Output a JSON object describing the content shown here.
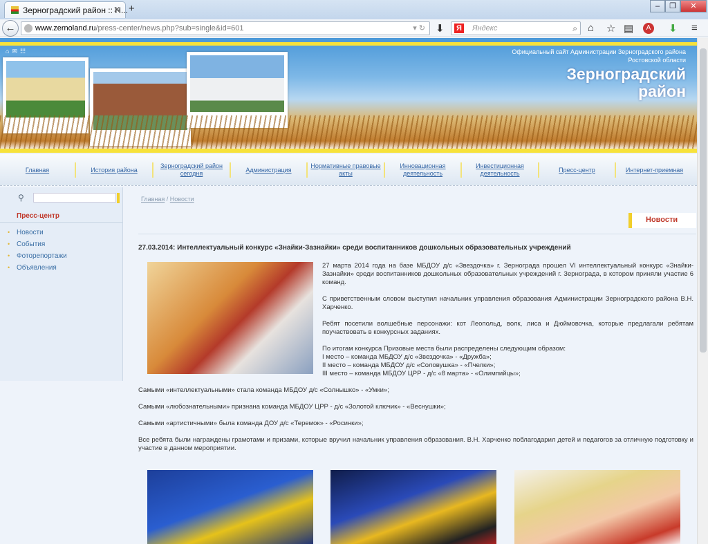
{
  "browser": {
    "tab_title": "Зерноградский район :: Н...",
    "url_host": "www.zernoland.ru",
    "url_path": "/press-center/news.php?sub=single&id=601",
    "search_placeholder": "Яндекс"
  },
  "header": {
    "official_line1": "Официальный сайт Администрации Зерноградского района",
    "official_line2": "Ростовской области",
    "district_line1": "Зерноградский",
    "district_line2": "район"
  },
  "menu": [
    {
      "label": "Главная"
    },
    {
      "label": "История района"
    },
    {
      "label": "Зерноградский район сегодня"
    },
    {
      "label": "Администрация"
    },
    {
      "label": "Нормативные правовые акты"
    },
    {
      "label": "Инновационная деятельность"
    },
    {
      "label": "Инвестиционная деятельность"
    },
    {
      "label": "Пресс-центр"
    },
    {
      "label": "Интернет-приемная"
    }
  ],
  "sidebar": {
    "section_title": "Пресс-центр",
    "items": [
      "Новости",
      "События",
      "Фоторепортажи",
      "Объявления"
    ]
  },
  "breadcrumb": {
    "home": "Главная",
    "sep": " / ",
    "current": "Новости"
  },
  "news_label": "Новости",
  "article": {
    "title": "27.03.2014: Интеллектуальный конкурс «Знайки-Зазнайки» среди воспитанников дошкольных образовательных учреждений",
    "p1": "27 марта 2014 года на базе МБДОУ д/с «Звездочка» г. Зернограда прошел VI интеллектуальный конкурс «Знайки-Зазнайки» среди воспитанников дошкольных образовательных учреждений г. Зернограда, в котором приняли участие 6 команд.",
    "p2": "С приветственным словом выступил начальник управления образования Администрации Зерноградского района В.Н. Харченко.",
    "p3": "Ребят посетили волшебные персонажи: кот Леопольд, волк, лиса и Дюймовочка, которые предлагали ребятам поучаствовать в конкурсных заданиях.",
    "p4_intro": "По итогам конкурса Призовые места были распределены следующим образом:",
    "place1": "I место – команда МБДОУ д/с «Звездочка» - «Дружба»;",
    "place2": "II место – команда МБДОУ д/с «Соловушка» - «Пчелки»;",
    "place3": "III место – команда МБДОУ ЦРР - д/с «8 марта» - «Олимпийцы»;",
    "p5": "Самыми «интеллектуальными» стала команда МБДОУ д/с «Солнышко» - «Умки»;",
    "p6": "Самыми «любознательными» признана команда МБДОУ ЦРР - д/с «Золотой ключик» - «Веснушки»;",
    "p7": "Самыми «артистичными» была команда ДОУ д/с «Теремок» - «Росинки»;",
    "p8": "Все ребята были награждены грамотами и призами, которые вручил начальник управления образования. В.Н. Харченко поблагодарил детей и педагогов за отличную подготовку и участие в данном мероприятии."
  }
}
